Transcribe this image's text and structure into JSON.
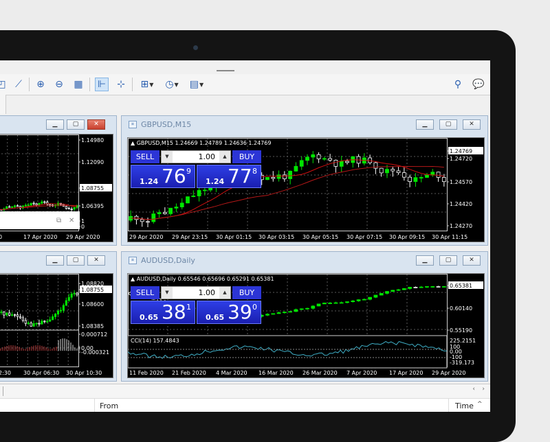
{
  "toolbar": {
    "icons": [
      "line-studies-icon",
      "trendline-icon",
      "zoom-in-icon",
      "zoom-out-icon",
      "tile-windows-icon",
      "period-separators-icon",
      "crosshair-icon",
      "add-indicator-icon",
      "timer-icon",
      "templates-icon",
      "search-icon",
      "chat-icon"
    ]
  },
  "windows": {
    "left_top": {
      "prices": [
        "1.14980",
        "1.12090",
        "1.08755",
        "1.06395",
        "1",
        "0"
      ],
      "dates": [
        "0",
        "17 Apr 2020",
        "29 Apr 2020"
      ]
    },
    "gbpusd": {
      "title": "GBPUSD,M15",
      "info": "GBPUSD,M15  1.24669 1.24789 1.24636 1.24769",
      "sell_label": "SELL",
      "buy_label": "BUY",
      "lot": "1.00",
      "sell_price": {
        "prefix": "1.24",
        "big": "76",
        "sup": "9"
      },
      "buy_price": {
        "prefix": "1.24",
        "big": "77",
        "sup": "8"
      },
      "prices": [
        "1.24769",
        "1.24720",
        "1.24570",
        "1.24420",
        "1.24270"
      ],
      "dates": [
        "29 Apr 2020",
        "29 Apr 23:15",
        "30 Apr 01:15",
        "30 Apr 03:15",
        "30 Apr 05:15",
        "30 Apr 07:15",
        "30 Apr 09:15",
        "30 Apr 11:15"
      ]
    },
    "left_bottom": {
      "prices": [
        "1.08820",
        "1.08755",
        "1.08600",
        "1.08385",
        "0.000712",
        "0.00",
        "-0.000321"
      ],
      "dates": [
        "2:30",
        "30 Apr 06:30",
        "30 Apr 10:30"
      ]
    },
    "audusd": {
      "title": "AUDUSD,Daily",
      "info": "AUDUSD,Daily  0.65546 0.65696 0.65291 0.65381",
      "sell_label": "SELL",
      "buy_label": "BUY",
      "lot": "1.00",
      "sell_price": {
        "prefix": "0.65",
        "big": "38",
        "sup": "1"
      },
      "buy_price": {
        "prefix": "0.65",
        "big": "39",
        "sup": "0"
      },
      "prices": [
        "0.65381",
        "0.60140",
        "0.55190"
      ],
      "cci_label": "CCI(14) 157.4843",
      "cci_levels": [
        "225.2151",
        "100",
        "0.00",
        "-100",
        "-319.173"
      ],
      "dates": [
        "11 Feb 2020",
        "21 Feb 2020",
        "4 Mar 2020",
        "16 Mar 2020",
        "26 Mar 2020",
        "7 Apr 2020",
        "17 Apr 2020",
        "29 Apr 2020"
      ]
    }
  },
  "table_header": {
    "from": "From",
    "time": "Time"
  },
  "colors": {
    "bull": "#00e600",
    "bear": "#ffffff",
    "ma_red": "#d01010",
    "cci": "#3fb0c8",
    "trade_blue": "#2c35d6"
  }
}
